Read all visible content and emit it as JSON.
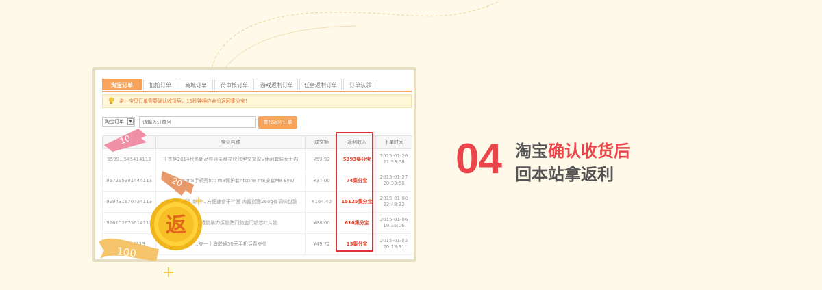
{
  "tabs": [
    {
      "label": "淘宝订单",
      "active": true
    },
    {
      "label": "拍拍订单"
    },
    {
      "label": "商城订单"
    },
    {
      "label": "待审核订单"
    },
    {
      "label": "游戏返利订单"
    },
    {
      "label": "任务返利订单"
    },
    {
      "label": "订单认领"
    }
  ],
  "notice": "亲！宝贝订单需要确认收货后，15秒钟相应会分返回集分宝！",
  "search": {
    "type_value": "淘宝订单",
    "placeholder": "请输入订单号",
    "button_label": "查找返利订单"
  },
  "table": {
    "headers": [
      "",
      "宝贝名称",
      "成交额",
      "返利收入",
      "下单时间"
    ],
    "rows": [
      {
        "id": "9599...545414113",
        "name": "千衣美2014秋冬新品性感麦穗花纹修型交叉深V休闲套装女士内",
        "amount": "¥59.92",
        "rebate": "5393集分宝",
        "date": "2015-01-26",
        "time": "21:33:08"
      },
      {
        "id": "957295391444113",
        "name": "htc one m8手机壳htc m8保护套htcone m8皮套M8 Eye/",
        "amount": "¥37.00",
        "rebate": "74集分宝",
        "date": "2015-01-27",
        "time": "20:33:50"
      },
      {
        "id": "929431870734113",
        "name": "【漫食生活】新鲜...方便速食干拌面 肉酱捞面280g有调味包装",
        "amount": "¥164.40",
        "rebate": "15125集分宝",
        "date": "2015-01-08",
        "time": "23:48:32"
      },
      {
        "id": "926102673014113",
        "name": "...C级防撬锁暴力拆锁防门防盗门锁芯叶片锁",
        "amount": "¥88.00",
        "rebate": "616集分宝",
        "date": "2015-01-06",
        "time": "19:35:06"
      },
      {
        "id": "...198784113",
        "name": "...充一上海联通50元手机话费充值",
        "amount": "¥49.72",
        "rebate": "15集分宝",
        "date": "2015-01-02",
        "time": "20:13:31"
      }
    ]
  },
  "step": {
    "number": "04",
    "line1_a": "淘宝",
    "line1_b": "确认收货后",
    "line2": "回本站拿返利"
  },
  "decor": {
    "ribbon_pink": "10",
    "ribbon_orange": "20",
    "ribbon_yellow": "100",
    "coin_char": "返"
  },
  "colors": {
    "accent_orange": "#f7a45c",
    "highlight_red": "#d9353a",
    "step_red": "#e9454a",
    "background": "#fff9e9"
  }
}
